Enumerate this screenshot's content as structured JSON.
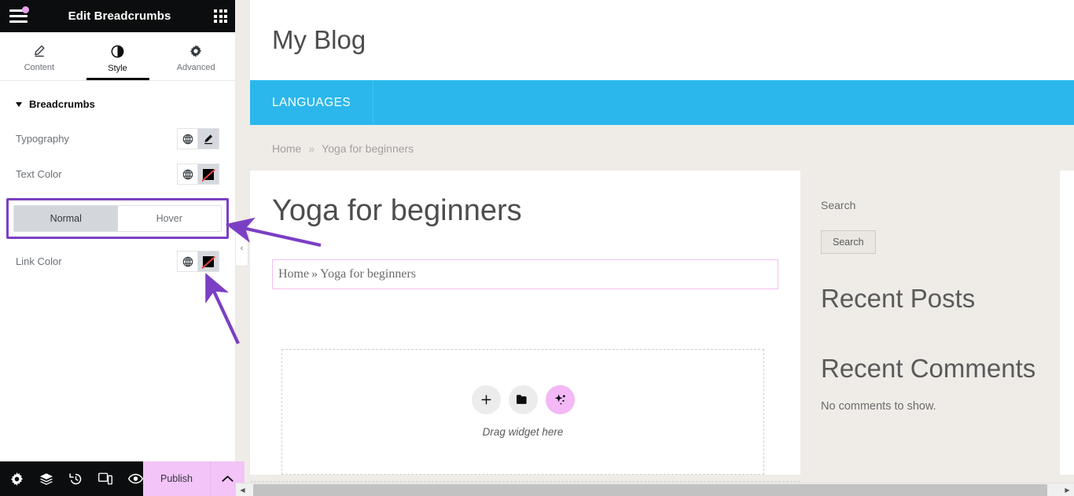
{
  "panel": {
    "header": {
      "menu_icon": "hamburger-icon",
      "notification_dot": true,
      "title": "Edit Breadcrumbs",
      "apps_icon": "apps-grid-icon"
    },
    "tabs": [
      {
        "label": "Content",
        "icon": "pencil-icon",
        "active": false
      },
      {
        "label": "Style",
        "icon": "contrast-icon",
        "active": true
      },
      {
        "label": "Advanced",
        "icon": "gear-icon",
        "active": false
      }
    ],
    "section": {
      "title": "Breadcrumbs",
      "expanded": true
    },
    "controls": [
      {
        "label": "Typography",
        "globe_icon": "globe-icon",
        "action_icon": "pencil-icon"
      },
      {
        "label": "Text Color",
        "globe_icon": "globe-icon",
        "action_icon": "color-swatch-icon",
        "swatch": "#000000"
      }
    ],
    "state_tabs": {
      "highlighted": true,
      "options": [
        "Normal",
        "Hover"
      ],
      "active": "Normal"
    },
    "link_control": {
      "label": "Link Color",
      "globe_icon": "globe-icon",
      "action_icon": "color-swatch-icon",
      "swatch": "#000000"
    },
    "footer": {
      "icons": [
        "gear-icon",
        "layers-icon",
        "history-icon",
        "responsive-icon",
        "preview-icon"
      ],
      "publish_label": "Publish",
      "publish_caret": "chevron-up-icon",
      "publish_color": "#f2c4f7"
    },
    "collapse_handle": "‹"
  },
  "canvas": {
    "site_title": "My Blog",
    "nav": [
      {
        "label": "LANGUAGES"
      }
    ],
    "nav_color": "#2bb7ec",
    "theme_breadcrumb": {
      "home": "Home",
      "separator": "»",
      "current": "Yoga for beginners"
    },
    "post_title": "Yoga for beginners",
    "breadcrumb_widget": {
      "home": "Home",
      "separator": "»",
      "current": "Yoga for beginners",
      "selected": true,
      "outline_color": "#f3bdf0"
    },
    "dropzone": {
      "label": "Drag widget here",
      "buttons": [
        {
          "icon": "plus-icon",
          "kind": "add"
        },
        {
          "icon": "folder-icon",
          "kind": "template"
        },
        {
          "icon": "ai-sparkle-icon",
          "kind": "ai"
        }
      ]
    },
    "sidebar": {
      "search_label": "Search",
      "search_button": "Search",
      "recent_posts_title": "Recent Posts",
      "recent_comments_title": "Recent Comments",
      "no_comments_text": "No comments to show."
    }
  },
  "annotations": {
    "arrow_color": "#7b3fc4",
    "highlight_color": "#7b3fc4",
    "arrows": [
      {
        "target": "state-tabs"
      },
      {
        "target": "link-color-swatch"
      }
    ]
  },
  "scrollbars": {
    "horizontal": {
      "left_arrow": "◀",
      "right_arrow": "▶"
    }
  }
}
